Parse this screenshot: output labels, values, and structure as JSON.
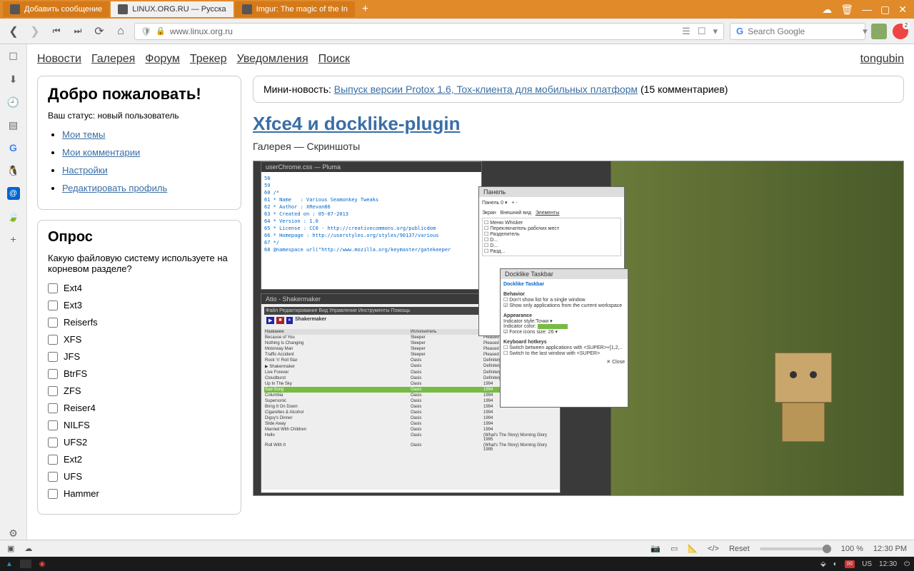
{
  "tabs": [
    {
      "label": "Добавить сообщение"
    },
    {
      "label": "LINUX.ORG.RU — Русска"
    },
    {
      "label": "Imgur: The magic of the In"
    }
  ],
  "url": "www.linux.org.ru",
  "search_placeholder": "Search Google",
  "nav": {
    "news": "Новости",
    "gallery": "Галерея",
    "forum": "Форум",
    "tracker": "Трекер",
    "notifications": "Уведомления",
    "search": "Поиск"
  },
  "username": "tongubin",
  "welcome": {
    "title": "Добро пожаловать!",
    "status": "Ваш статус: новый пользователь",
    "links": [
      "Мои темы",
      "Мои комментарии",
      "Настройки",
      "Редактировать профиль"
    ]
  },
  "poll": {
    "title": "Опрос",
    "question": "Какую файловую систему используете на корневом разделе?",
    "options": [
      "Ext4",
      "Ext3",
      "Reiserfs",
      "XFS",
      "JFS",
      "BtrFS",
      "ZFS",
      "Reiser4",
      "NILFS",
      "UFS2",
      "Ext2",
      "UFS",
      "Hammer"
    ]
  },
  "mini_news": {
    "prefix": "Мини-новость: ",
    "link": "Выпуск версии Protox 1.6, Tox-клиента для мобильных платформ",
    "suffix": " (15 комментариев)"
  },
  "article": {
    "title": "Xfce4 и docklike-plugin",
    "crumb": "Галерея — Скриншоты"
  },
  "dev": {
    "reset": "Reset",
    "zoom": "100 %",
    "time": "12:30 PM"
  },
  "os": {
    "lang": "US",
    "time": "12:30"
  }
}
